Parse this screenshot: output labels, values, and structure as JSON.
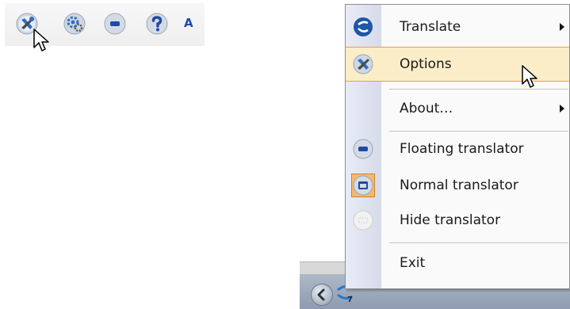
{
  "toolbar": {
    "buttons": [
      {
        "name": "options",
        "icon": "tools-icon"
      },
      {
        "name": "settings",
        "icon": "gear-icon"
      },
      {
        "name": "minimize",
        "icon": "minus-icon"
      },
      {
        "name": "help",
        "icon": "help-icon"
      }
    ],
    "font_label": "A"
  },
  "menu": {
    "items": [
      {
        "label": "Translate",
        "icon": "translate-logo-icon",
        "submenu": true
      },
      {
        "label": "Options",
        "icon": "tools-icon",
        "highlighted": true
      },
      {
        "label": "About…",
        "submenu": true
      },
      {
        "label": "Floating translator",
        "icon": "minus-icon"
      },
      {
        "label": "Normal translator",
        "icon": "window-icon",
        "checked": true
      },
      {
        "label": "Hide translator",
        "icon": "dotted-icon",
        "disabled_look": true
      },
      {
        "label": "Exit"
      }
    ]
  },
  "taskbar": {
    "tray_icons": [
      "back-arrow-icon",
      "translator-tray-icon"
    ]
  },
  "colors": {
    "highlight_bg": "#fbedc8",
    "highlight_border": "#e3a24a",
    "accent_blue": "#1f4aa8"
  }
}
